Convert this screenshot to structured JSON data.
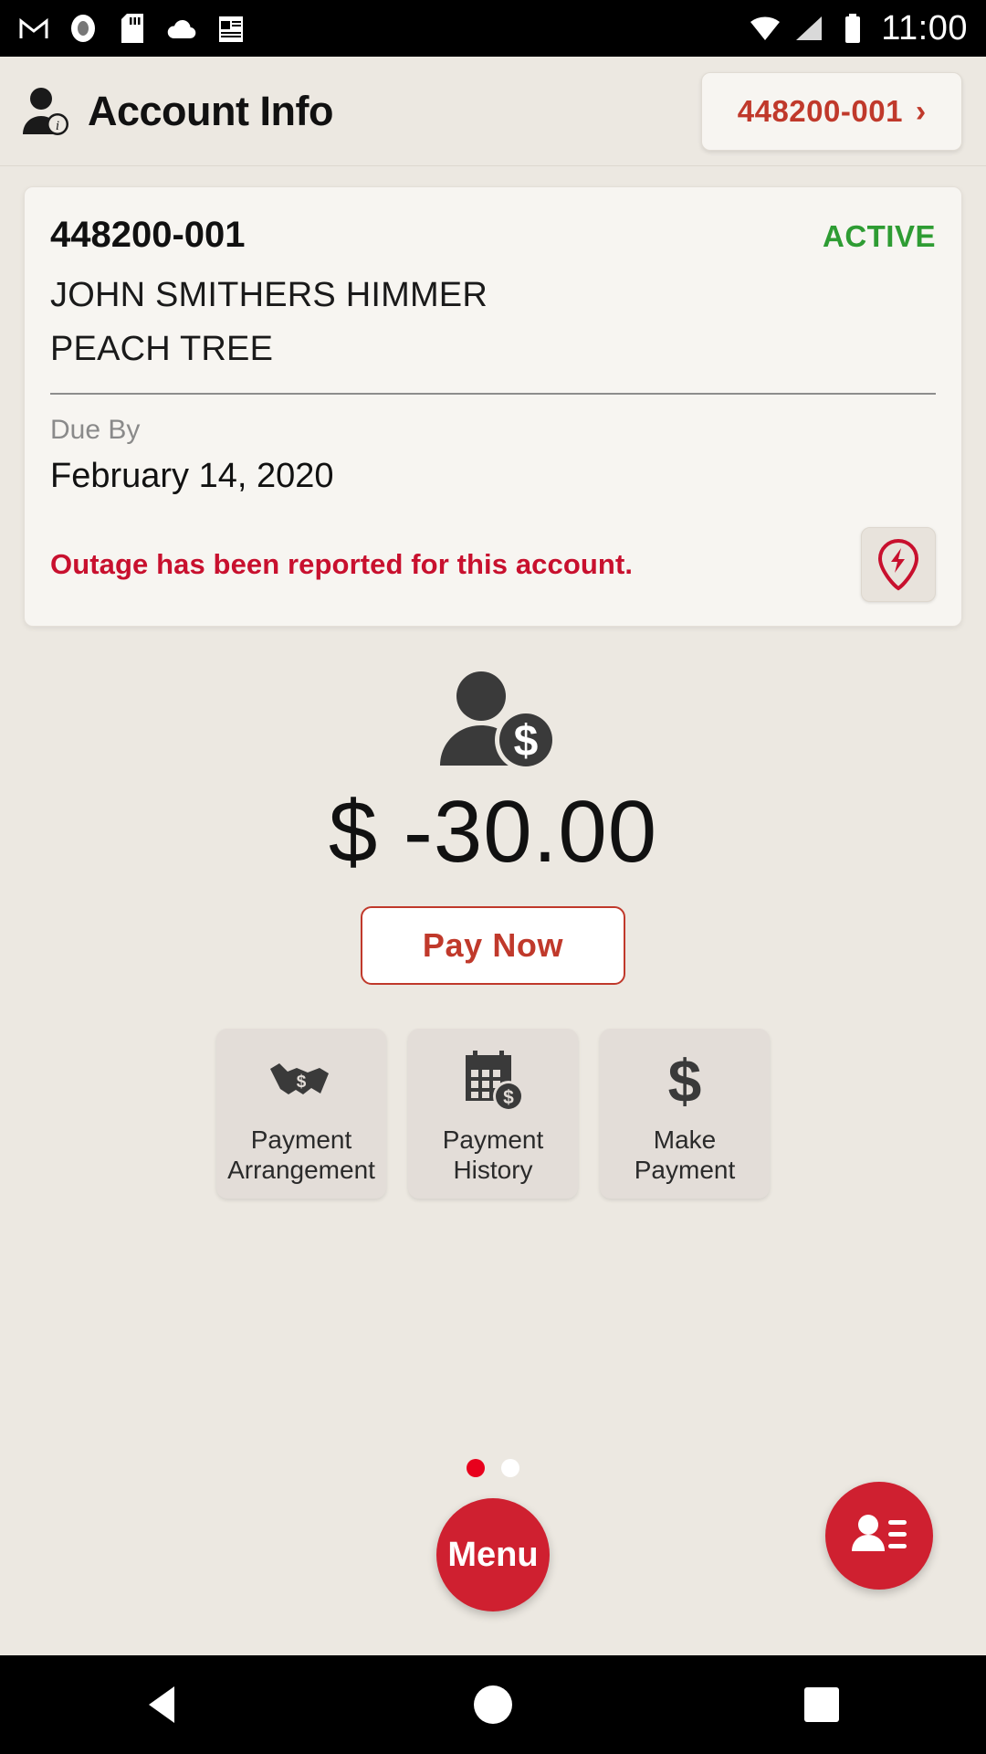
{
  "status_bar": {
    "time": "11:00",
    "left_icons": [
      "gmail-icon",
      "record-icon",
      "sd-card-icon",
      "cloud-icon",
      "news-icon"
    ],
    "right_icons": [
      "wifi-icon",
      "signal-icon",
      "battery-icon"
    ]
  },
  "app_bar": {
    "icon": "user-info-icon",
    "title": "Account Info",
    "account_chip": {
      "label": "448200-001",
      "chevron": "›"
    }
  },
  "account_card": {
    "account_number": "448200-001",
    "status": "ACTIVE",
    "status_color": "#2e9c33",
    "customer_name": "JOHN SMITHERS HIMMER",
    "service_address": "PEACH TREE",
    "due_by_label": "Due By",
    "due_date": "February 14, 2020",
    "outage_message": "Outage has been reported for this account.",
    "outage_message_color": "#c8102e",
    "outage_icon": "outage-bolt-pin-icon"
  },
  "balance": {
    "icon": "person-dollar-icon",
    "currency_symbol": "$",
    "amount": "-30.00",
    "display": "$ -30.00",
    "pay_now_label": "Pay Now",
    "accent_color": "#c0392b"
  },
  "quick_actions": [
    {
      "icon": "handshake-dollar-icon",
      "line1": "Payment",
      "line2": "Arrangement"
    },
    {
      "icon": "calendar-dollar-icon",
      "line1": "Payment",
      "line2": "History"
    },
    {
      "icon": "dollar-sign-icon",
      "line1": "Make",
      "line2": "Payment"
    }
  ],
  "pager": {
    "total": 2,
    "active_index": 0,
    "active_color": "#e8001c",
    "inactive_color": "#ffffff"
  },
  "floating_buttons": {
    "menu": {
      "label": "Menu",
      "color": "#cf2030"
    },
    "contacts": {
      "icon": "contacts-icon",
      "color": "#cf2030"
    }
  },
  "nav_bar": {
    "buttons": [
      "back-icon",
      "home-icon",
      "recents-icon"
    ]
  }
}
